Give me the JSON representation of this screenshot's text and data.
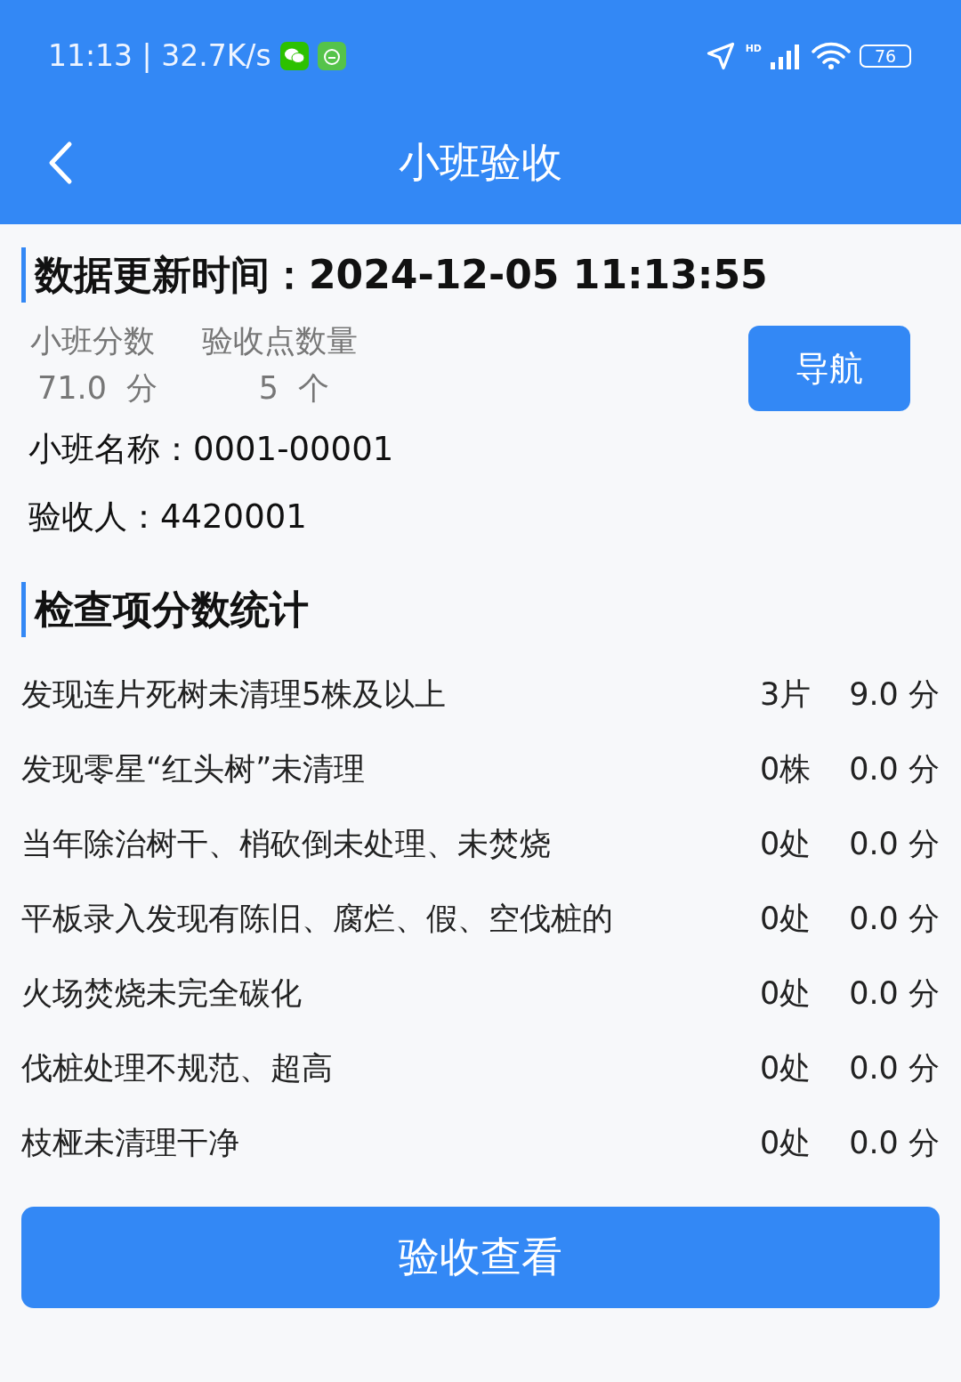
{
  "status_bar": {
    "time": "11:13 | 32.7K/s",
    "hd": "HD",
    "battery": "76"
  },
  "header": {
    "title": "小班验收"
  },
  "update": {
    "label": "数据更新时间：",
    "value": "2024-12-05 11:13:55"
  },
  "stats": [
    {
      "label": "小班分数",
      "value": "71.0",
      "unit": "分"
    },
    {
      "label": "验收点数量",
      "value": "5",
      "unit": "个"
    }
  ],
  "nav_button": "导航",
  "info": [
    {
      "label": "小班名称：",
      "value": "0001-00001"
    },
    {
      "label": "验收人：",
      "value": "4420001"
    }
  ],
  "section_title": "检查项分数统计",
  "items": [
    {
      "name": "发现连片死树未清理5株及以上",
      "count": "3片",
      "score": "9.0 分"
    },
    {
      "name": "发现零星“红头树”未清理",
      "count": "0株",
      "score": "0.0 分"
    },
    {
      "name": "当年除治树干、梢砍倒未处理、未焚烧",
      "count": "0处",
      "score": "0.0 分"
    },
    {
      "name": "平板录入发现有陈旧、腐烂、假、空伐桩的",
      "count": "0处",
      "score": "0.0 分"
    },
    {
      "name": "火场焚烧未完全碳化",
      "count": "0处",
      "score": "0.0 分"
    },
    {
      "name": "伐桩处理不规范、超高",
      "count": "0处",
      "score": "0.0 分"
    },
    {
      "name": "枝桠未清理干净",
      "count": "0处",
      "score": "0.0 分"
    }
  ],
  "bottom_button": "验收查看"
}
